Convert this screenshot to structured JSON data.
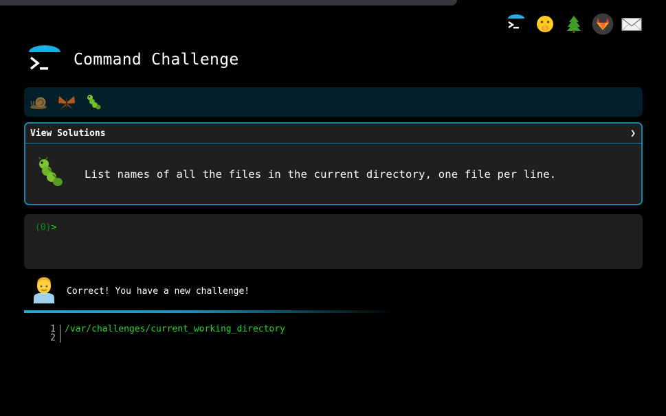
{
  "header": {
    "title": "Command Challenge"
  },
  "nav_icons": [
    "terminal-logo-icon",
    "hushed-face-icon",
    "tree-icon",
    "gitlab-icon",
    "envelope-icon"
  ],
  "levels": [
    "snail-icon",
    "butterfly-icon",
    "caterpillar-icon"
  ],
  "challenge": {
    "toggle_label": "View Solutions",
    "toggle_arrow": "❯",
    "task": "List names of all the files in the current directory, one file per line."
  },
  "terminal": {
    "exit_code": "(0)",
    "prompt": ">"
  },
  "feedback": {
    "message": "Correct! You have a new challenge!"
  },
  "output": {
    "lines": [
      {
        "num": "1",
        "text": "/var/challenges/current_working_directory"
      },
      {
        "num": "2",
        "text": ""
      }
    ]
  },
  "colors": {
    "accent": "#1b84a8",
    "prompt_green": "#2bd22b",
    "level_bar": "#03202a"
  }
}
